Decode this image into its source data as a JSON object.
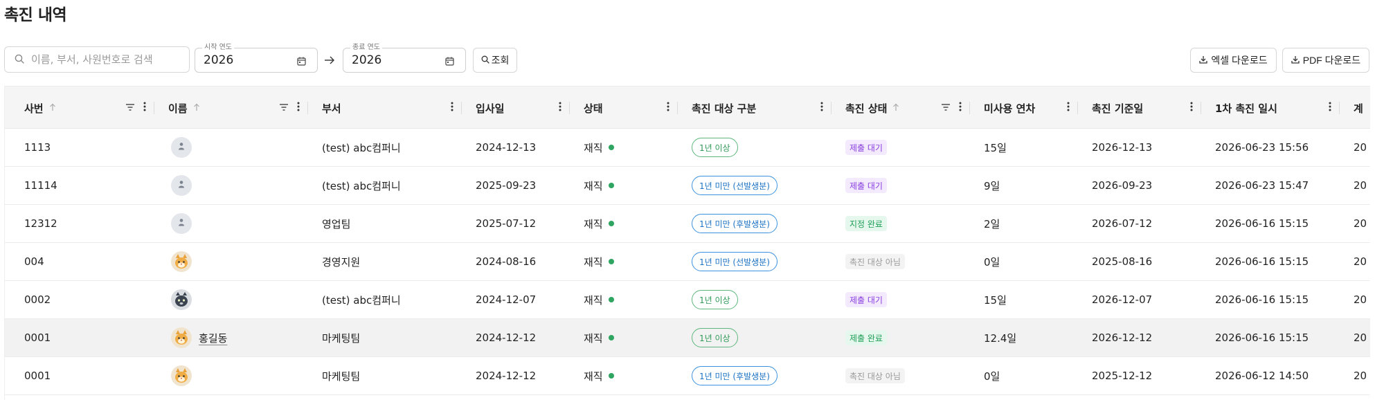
{
  "page": {
    "title": "촉진 내역"
  },
  "search": {
    "placeholder": "이름, 부서, 사원번호로 검색"
  },
  "filters": {
    "start_year_label": "시작 연도",
    "start_year_value": "2026",
    "end_year_label": "종료 연도",
    "end_year_value": "2026",
    "query_label": "조회"
  },
  "downloads": {
    "excel_label": "엑셀 다운로드",
    "pdf_label": "PDF 다운로드"
  },
  "table": {
    "columns": [
      {
        "label": "사번"
      },
      {
        "label": "이름"
      },
      {
        "label": "부서"
      },
      {
        "label": "입사일"
      },
      {
        "label": "상태"
      },
      {
        "label": "촉진 대상 구분"
      },
      {
        "label": "촉진 상태"
      },
      {
        "label": "미사용 연차"
      },
      {
        "label": "촉진 기준일"
      },
      {
        "label": "1차 촉진 일시"
      },
      {
        "label": "계"
      }
    ],
    "rows": [
      {
        "emp_no": "1113",
        "name": "",
        "avatar": "default",
        "dept": "(test) abc컴퍼니",
        "hire_date": "2024-12-13",
        "status": "재직",
        "target": "1년 이상",
        "target_color": "green",
        "promo_status": "제출 대기",
        "promo_kind": "wait",
        "unused": "15일",
        "base_date": "2026-12-13",
        "first_promo": "2026-06-23 15:56",
        "next": "20"
      },
      {
        "emp_no": "11114",
        "name": "",
        "avatar": "default",
        "dept": "(test) abc컴퍼니",
        "hire_date": "2025-09-23",
        "status": "재직",
        "target": "1년 미만 (선발생분)",
        "target_color": "blue",
        "promo_status": "제출 대기",
        "promo_kind": "wait",
        "unused": "9일",
        "base_date": "2026-09-23",
        "first_promo": "2026-06-23 15:47",
        "next": "20"
      },
      {
        "emp_no": "12312",
        "name": "",
        "avatar": "default",
        "dept": "영업팀",
        "hire_date": "2025-07-12",
        "status": "재직",
        "target": "1년 미만 (후발생분)",
        "target_color": "blue",
        "promo_status": "지정 완료",
        "promo_kind": "done",
        "unused": "2일",
        "base_date": "2026-07-12",
        "first_promo": "2026-06-16 15:15",
        "next": "20"
      },
      {
        "emp_no": "004",
        "name": "",
        "avatar": "cat",
        "dept": "경영지원",
        "hire_date": "2024-08-16",
        "status": "재직",
        "target": "1년 미만 (선발생분)",
        "target_color": "blue",
        "promo_status": "촉진 대상 아님",
        "promo_kind": "none",
        "unused": "0일",
        "base_date": "2025-08-16",
        "first_promo": "2026-06-16 15:15",
        "next": "20"
      },
      {
        "emp_no": "0002",
        "name": "",
        "avatar": "dark",
        "dept": "(test) abc컴퍼니",
        "hire_date": "2024-12-07",
        "status": "재직",
        "target": "1년 이상",
        "target_color": "green",
        "promo_status": "제출 대기",
        "promo_kind": "wait",
        "unused": "15일",
        "base_date": "2026-12-07",
        "first_promo": "2026-06-16 15:15",
        "next": "20"
      },
      {
        "emp_no": "0001",
        "name": "홍길동",
        "avatar": "cat",
        "dept": "마케팅팀",
        "hire_date": "2024-12-12",
        "status": "재직",
        "target": "1년 이상",
        "target_color": "green",
        "promo_status": "제출 완료",
        "promo_kind": "done",
        "unused": "12.4일",
        "base_date": "2026-12-12",
        "first_promo": "2026-06-16 15:15",
        "next": "20",
        "highlight": true
      },
      {
        "emp_no": "0001",
        "name": "",
        "avatar": "cat",
        "dept": "마케팅팀",
        "hire_date": "2024-12-12",
        "status": "재직",
        "target": "1년 미만 (후발생분)",
        "target_color": "blue",
        "promo_status": "촉진 대상 아님",
        "promo_kind": "none",
        "unused": "0일",
        "base_date": "2025-12-12",
        "first_promo": "2026-06-12 14:50",
        "next": "20"
      }
    ]
  },
  "icons": {
    "search": "search-icon",
    "calendar": "calendar-icon",
    "arrow": "arrow-right-icon",
    "download": "download-icon",
    "filter": "filter-icon",
    "more": "more-vertical-icon",
    "sort": "sort-up-icon",
    "user": "user-icon"
  },
  "colors": {
    "status_active": "#2fa561",
    "badge_blue": "#1c73c4",
    "badge_green": "#2f9a57",
    "wait_purple": "#8a3fe0",
    "done_green": "#1e9e57"
  }
}
